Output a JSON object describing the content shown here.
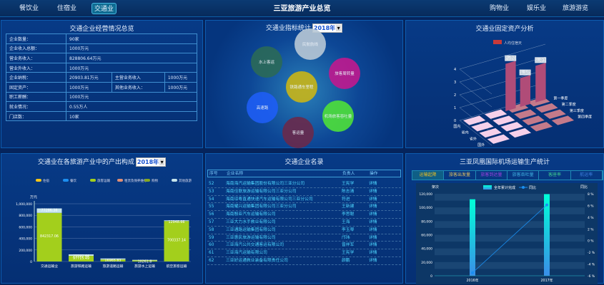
{
  "header": {
    "title": "三亚旅游产业总览",
    "nav_left": [
      "餐饮业",
      "住宿业",
      "交通业"
    ],
    "active": "交通业",
    "nav_right": [
      "购物业",
      "娱乐业",
      "旅游游览"
    ]
  },
  "overview": {
    "title": "交通企业经营情况总览",
    "rows": [
      [
        "企业数量：",
        "90家"
      ],
      [
        "企业收入总额：",
        "1000万元"
      ],
      [
        "营业务收入：",
        "828806.64万元"
      ],
      [
        "营业外收入：",
        "1000万元"
      ],
      [
        "企业纳税：",
        "20903.81万元",
        "主营业务收入",
        "1000万元"
      ],
      [
        "固定资产：",
        "1000万元",
        "其他业务收入：",
        "1000万元"
      ],
      [
        "职工薪酬：",
        "1000万元"
      ],
      [
        "就业情况：",
        "0.55万人"
      ],
      [
        "门店数：",
        "10家"
      ]
    ]
  },
  "indicators": {
    "title": "交通业指标统计",
    "year": "2018年",
    "bubbles": [
      {
        "label": "民航航线",
        "color": "#b8c8d6"
      },
      {
        "label": "水上客运",
        "color": "#2b6a58"
      },
      {
        "label": "旅客周转量",
        "color": "#c0198f"
      },
      {
        "label": "铁路通车里程",
        "color": "#c9b517"
      },
      {
        "label": "高速路",
        "color": "#1e5ef5"
      },
      {
        "label": "机场旅客吞吐量",
        "color": "#4ee03a"
      },
      {
        "label": "客运量",
        "color": "#6a2a4c"
      }
    ]
  },
  "fixed_assets": {
    "title": "交通业固定资产分析",
    "legend": "人均住宿天",
    "yticks": [
      "0",
      "1",
      "2",
      "3",
      "4"
    ],
    "rows": [
      "国外",
      "省外",
      "省内",
      "国内"
    ],
    "cols": [
      "第一季度",
      "第二季度",
      "第三季度",
      "第四季度"
    ],
    "bar_labels": [
      "3.69",
      "2.25",
      "2.86"
    ],
    "zero_label": "0"
  },
  "output": {
    "title": "交通业在各旅游产业中的产出构成",
    "year": "2018年",
    "unit": "万元",
    "legend": [
      {
        "name": "住宿",
        "color": "#f5c518"
      },
      {
        "name": "餐饮",
        "color": "#1c8ef0"
      },
      {
        "name": "旅客运输",
        "color": "#a3cf1c"
      },
      {
        "name": "租赁及保养维修",
        "color": "#e08e74"
      },
      {
        "name": "购物",
        "color": "#86a820"
      },
      {
        "name": "其他旅游",
        "color": "#c6e4ec"
      }
    ]
  },
  "chart_data": [
    {
      "type": "bar",
      "stacked": true,
      "ylabel": "万元",
      "ylim": [
        0,
        1000000
      ],
      "yticks": [
        "0",
        "200,000",
        "400,000",
        "600,000",
        "800,000",
        "1,000,000"
      ],
      "categories": [
        "交通运输业",
        "旅游铁路运输",
        "旅游道路运输",
        "旅游水上运输",
        "航空旅客运输"
      ],
      "series": [
        {
          "name": "旅客运输",
          "values": [
            842317.06,
            97715.49,
            35000,
            18000,
            700337.14
          ]
        },
        {
          "name": "其他旅游",
          "values": [
            77286.38,
            25592.44,
            16965.83,
            10261.8,
            12948.66
          ]
        }
      ],
      "labels": [
        "842317.06",
        "77286.38",
        "97715.49",
        "25592.44",
        "16965.83",
        "10261.8",
        "700337.14",
        "12948.66"
      ]
    },
    {
      "type": "bar+line",
      "title": "三亚凤凰国际机场运输生产统计",
      "categories": [
        "2016年",
        "2017年"
      ],
      "ylabel_left": "架次",
      "ylabel_right": "同比",
      "yticks_left": [
        "0",
        "20,000",
        "40,000",
        "60,000",
        "80,000",
        "100,000",
        "120,000"
      ],
      "yticks_right": [
        "-6 %",
        "-4 %",
        "-2 %",
        "0 %",
        "2 %",
        "4 %",
        "6 %",
        "8 %"
      ],
      "ylim_left": [
        0,
        120000
      ],
      "ylim_right": [
        -6,
        8
      ],
      "series": [
        {
          "name": "全年累计完成",
          "type": "bar",
          "values": [
            112000,
            119500
          ]
        },
        {
          "name": "同比",
          "type": "line",
          "values": [
            -5.5,
            6.1
          ]
        }
      ]
    }
  ],
  "airport": {
    "tabs": [
      {
        "label": "运输起降",
        "color": "#f0c020"
      },
      {
        "label": "旅客出发量",
        "color": "#e0c060"
      },
      {
        "label": "旅客到达量",
        "color": "#a040e0"
      },
      {
        "label": "旅客吞吐量",
        "color": "#40b0e0"
      },
      {
        "label": "客座率",
        "color": "#40d090"
      },
      {
        "label": "航运率",
        "color": "#4080e0"
      }
    ]
  },
  "directory": {
    "title": "交通企业名录",
    "headers": [
      "序号",
      "企业名称",
      "负责人",
      "操作"
    ],
    "rows": [
      [
        "52",
        "海南海汽运输集团股份有限公司三亚分公司",
        "王宪学",
        "详情"
      ],
      [
        "53",
        "海南佳联旅游运输有限公司三亚分公司",
        "陈志清",
        "详情"
      ],
      [
        "54",
        "海南琼粤直通快速汽车运输有限公司三亚分公司",
        "符进",
        "详情"
      ],
      [
        "55",
        "海南耀兴运输集团有限公司三亚分公司",
        "王新建",
        "详情"
      ],
      [
        "56",
        "海南殷亚汽车运输有限公司",
        "李思聪",
        "详情"
      ],
      [
        "57",
        "三亚大力水手救业有限公司",
        "王海",
        "详情"
      ],
      [
        "58",
        "三亚通路运输集团有限公司",
        "李玉琴",
        "详情"
      ],
      [
        "59",
        "三亚惠民旅游运输有限公司",
        "邝玮",
        "详情"
      ],
      [
        "60",
        "三亚海汽公共交通客运有限公司",
        "曾祥军",
        "详情"
      ],
      [
        "61",
        "三亚海汽运输有限公司",
        "王宪学",
        "详情"
      ],
      [
        "62",
        "三亚好运通救业装备有限责任公司",
        "颜鹏",
        "详情"
      ]
    ]
  }
}
